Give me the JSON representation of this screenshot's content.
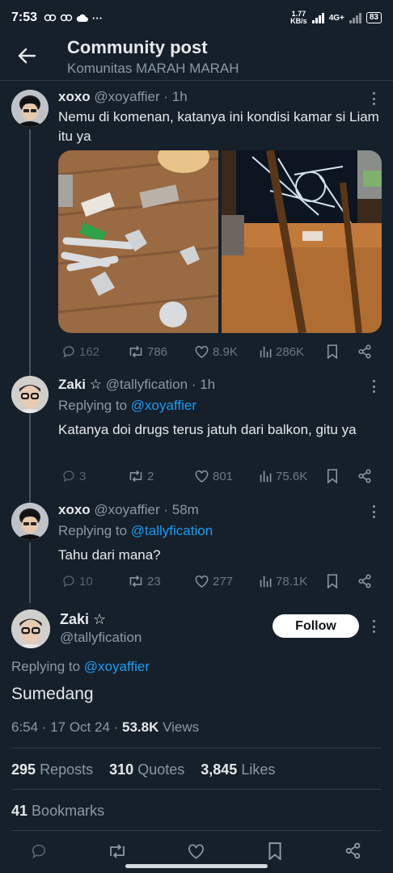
{
  "status_bar": {
    "time": "7:53",
    "net_speed_top": "1.77",
    "net_speed_bottom": "KB/s",
    "network": "4G+",
    "battery": "83"
  },
  "header": {
    "title": "Community post",
    "subtitle": "Komunitas MARAH MARAH"
  },
  "tweets": [
    {
      "name": "xoxo",
      "handle": "@xoyaffier",
      "time": "· 1h",
      "text": "Nemu di komenan, katanya ini kondisi kamar si Liam itu ya",
      "replies": "162",
      "reposts": "786",
      "likes": "8.9K",
      "views": "286K"
    },
    {
      "name": "Zaki ☆",
      "handle": "@tallyfication",
      "time": "· 1h",
      "reply_label": "Replying to",
      "reply_to": "@xoyaffier",
      "text": "Katanya doi drugs terus jatuh dari balkon, gitu ya",
      "replies": "3",
      "reposts": "2",
      "likes": "801",
      "views": "75.6K"
    },
    {
      "name": "xoxo",
      "handle": "@xoyaffier",
      "time": "· 58m",
      "reply_label": "Replying to",
      "reply_to": "@tallyfication",
      "text": "Tahu dari mana?",
      "replies": "10",
      "reposts": "23",
      "likes": "277",
      "views": "78.1K"
    }
  ],
  "main": {
    "name": "Zaki ☆",
    "handle": "@tallyfication",
    "follow_label": "Follow",
    "reply_label": "Replying to",
    "reply_to": "@xoyaffier",
    "text": "Sumedang",
    "time": "6:54 · 17 Oct 24 · ",
    "views_count": "53.8K",
    "views_label": " Views",
    "reposts_count": "295",
    "reposts_label": "Reposts",
    "quotes_count": "310",
    "quotes_label": "Quotes",
    "likes_count": "3,845",
    "likes_label": "Likes",
    "bookmarks_count": "41",
    "bookmarks_label": "Bookmarks"
  },
  "colors": {
    "background": "#15202b",
    "link": "#1d9bf0",
    "muted": "#8b98a5"
  }
}
